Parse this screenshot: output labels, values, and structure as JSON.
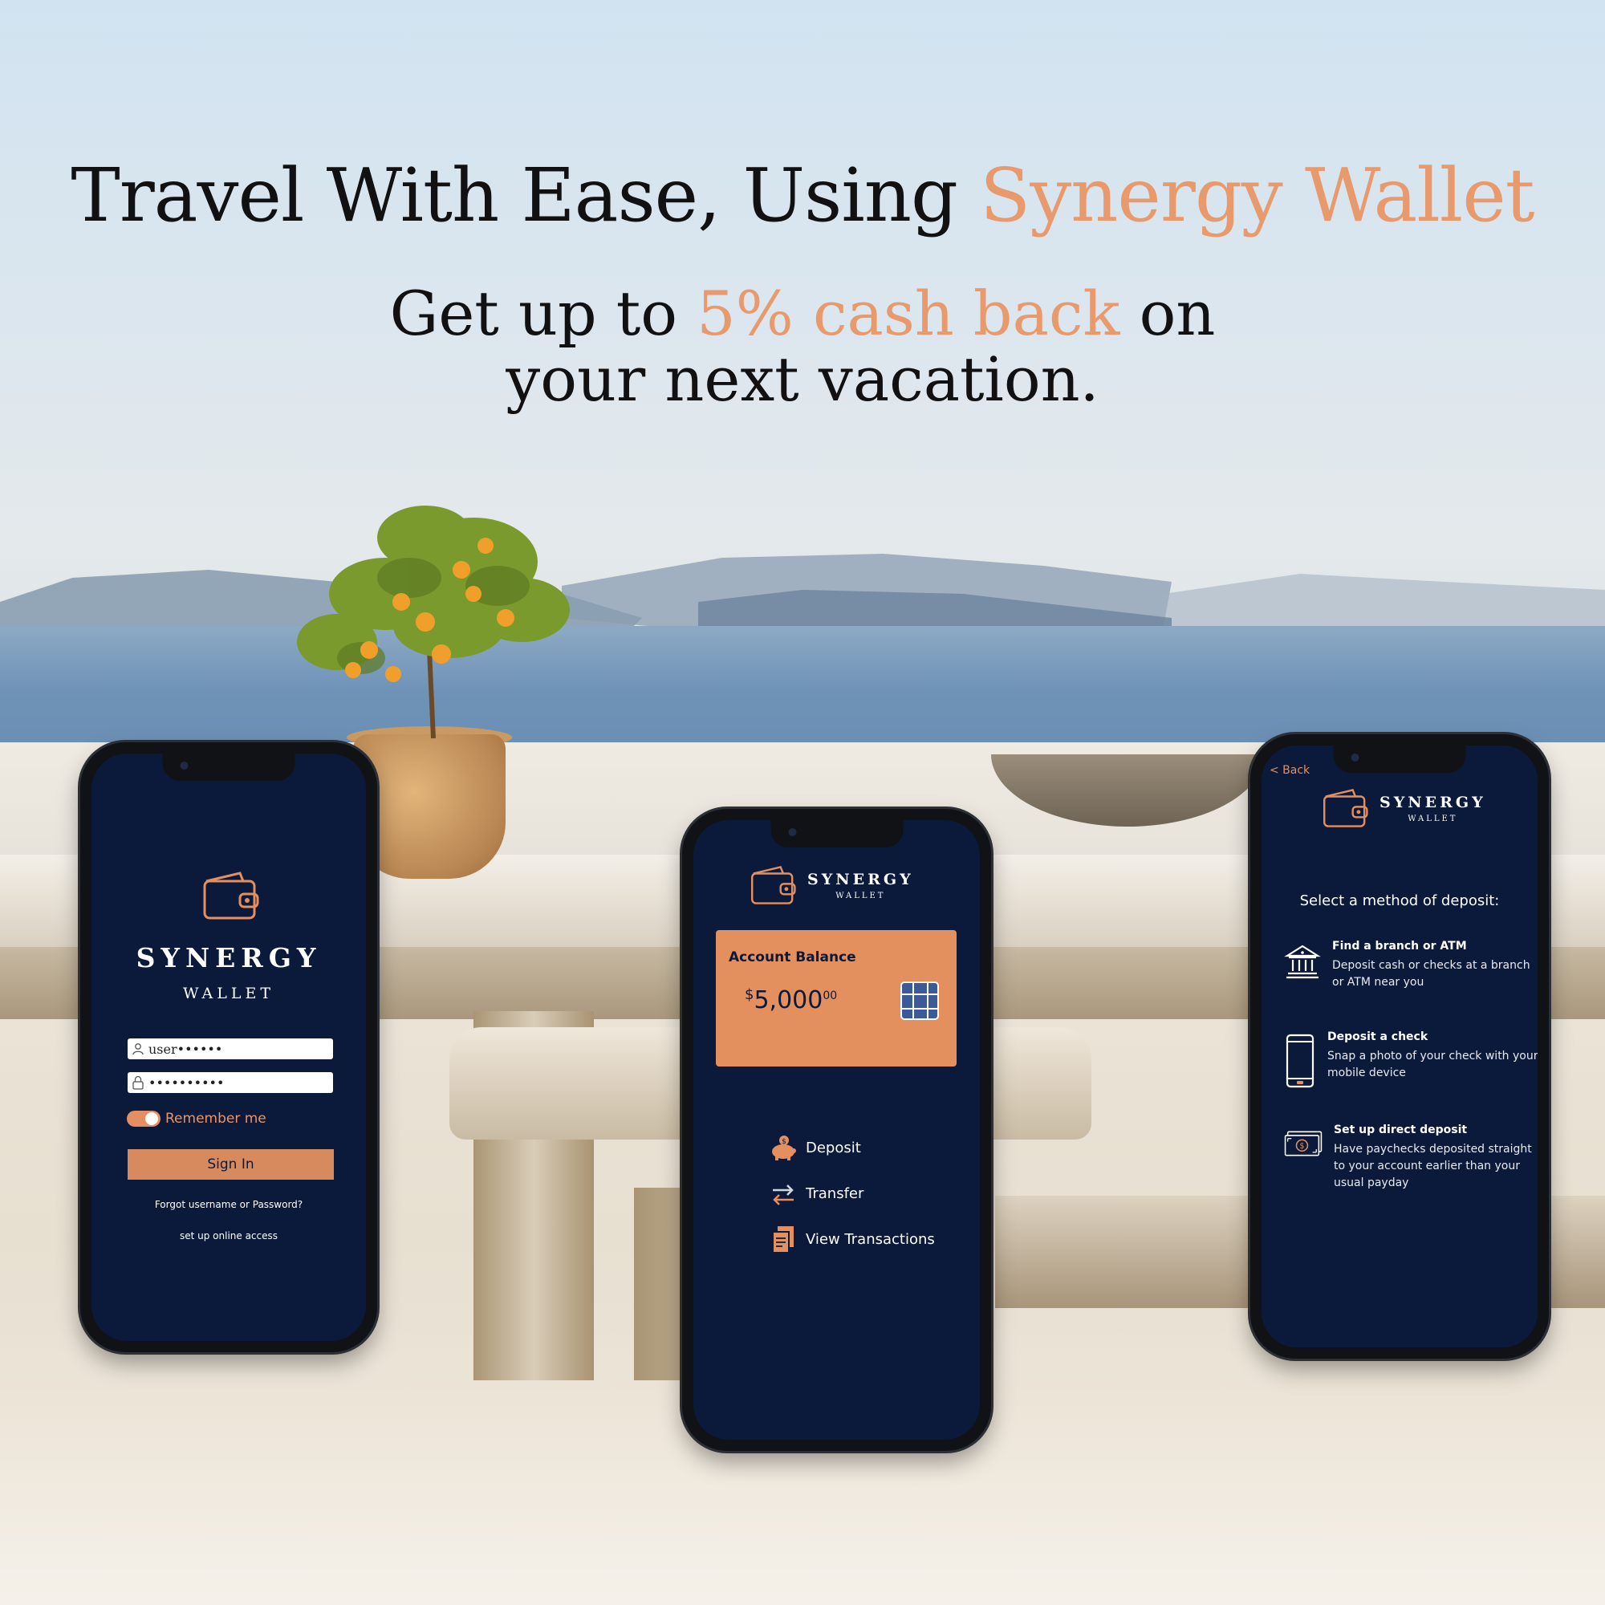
{
  "headline": {
    "prefix": "Travel With Ease, Using ",
    "accent": "Synergy Wallet"
  },
  "subline": {
    "part1": "Get  up to ",
    "accent": "5% cash back",
    "part2": " on",
    "line2": "your next vacation."
  },
  "colors": {
    "accent": "#e89a6c",
    "screen_bg": "#0b1a3a",
    "card_bg": "#e3905e"
  },
  "login_screen": {
    "brand": "SYNERGY",
    "brand_sub": "WALLET",
    "username_value": "user••••••",
    "password_value": "••••••••••",
    "remember_label": "Remember me",
    "sign_in_label": "Sign In",
    "forgot_label": "Forgot  username or Password?",
    "setup_label": "set up online access",
    "icons": [
      "wallet-icon",
      "user-icon",
      "lock-icon"
    ]
  },
  "dashboard_screen": {
    "brand": "SYNERGY",
    "brand_sub": "WALLET",
    "balance_label": "Account Balance",
    "balance_currency": "$",
    "balance_amount": "5,000",
    "balance_cents": "00",
    "menu": [
      {
        "label": "Deposit",
        "icon": "piggy-bank-icon"
      },
      {
        "label": "Transfer",
        "icon": "transfer-icon"
      },
      {
        "label": "View Transactions",
        "icon": "documents-icon"
      }
    ]
  },
  "deposit_screen": {
    "back_label": "< Back",
    "brand": "SYNERGY",
    "brand_sub": "WALLET",
    "heading": "Select a method of deposit:",
    "options": [
      {
        "title": "Find a branch or ATM",
        "desc": "Deposit cash or checks at a branch or ATM near you",
        "icon": "bank-icon"
      },
      {
        "title": "Deposit a check",
        "desc": "Snap a photo of your check with your mobile device",
        "icon": "mobile-phone-icon"
      },
      {
        "title": "Set up direct deposit",
        "desc": "Have paychecks deposited straight to your account earlier than your usual payday",
        "icon": "cash-icon"
      }
    ]
  }
}
